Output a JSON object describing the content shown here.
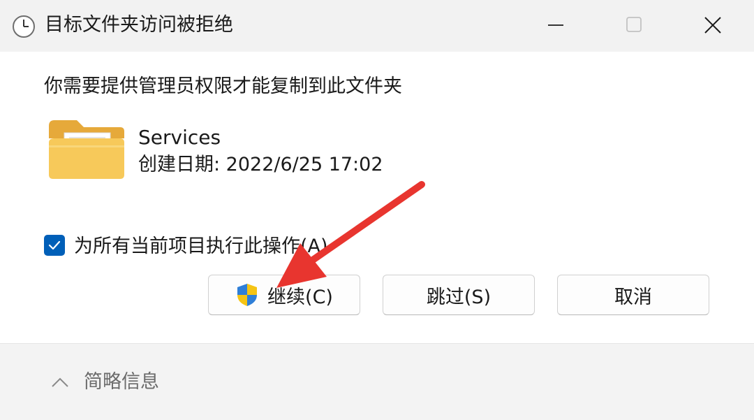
{
  "window": {
    "title": "目标文件夹访问被拒绝",
    "icon": "clock-icon",
    "controls": [
      "minimize-icon",
      "maximize-icon",
      "close-icon"
    ]
  },
  "message": "你需要提供管理员权限才能复制到此文件夹",
  "item": {
    "icon": "folder-icon",
    "name": "Services",
    "created": "创建日期: 2022/6/25 17:02"
  },
  "apply_all": {
    "label": "为所有当前项目执行此操作(A)",
    "checked": true
  },
  "buttons": {
    "continue": "继续(C)",
    "skip": "跳过(S)",
    "cancel": "取消"
  },
  "footer": {
    "details": "简略信息",
    "icon": "chevron-up-icon"
  },
  "colors": {
    "accent": "#005fb8",
    "annotation_arrow": "#e8352f"
  }
}
